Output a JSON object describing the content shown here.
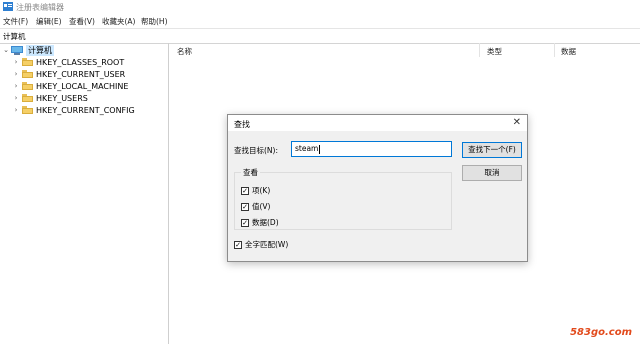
{
  "window": {
    "title": "注册表编辑器"
  },
  "menu": {
    "items": [
      "文件(F)",
      "编辑(E)",
      "查看(V)",
      "收藏夹(A)",
      "帮助(H)"
    ]
  },
  "address": {
    "path": "计算机"
  },
  "tree": {
    "root": "计算机",
    "keys": [
      "HKEY_CLASSES_ROOT",
      "HKEY_CURRENT_USER",
      "HKEY_LOCAL_MACHINE",
      "HKEY_USERS",
      "HKEY_CURRENT_CONFIG"
    ]
  },
  "list": {
    "columns": [
      "名称",
      "类型",
      "数据"
    ]
  },
  "dialog": {
    "title": "查找",
    "close": "✕",
    "find_label": "查找目标(N):",
    "find_value": "steam",
    "find_next": "查找下一个(F)",
    "cancel": "取消",
    "look_at": "查看",
    "options": [
      {
        "label": "项(K)",
        "checked": true
      },
      {
        "label": "值(V)",
        "checked": true
      },
      {
        "label": "数据(D)",
        "checked": true
      }
    ],
    "match_whole": {
      "label": "全字匹配(W)",
      "checked": true
    }
  },
  "watermark": "583go.com"
}
